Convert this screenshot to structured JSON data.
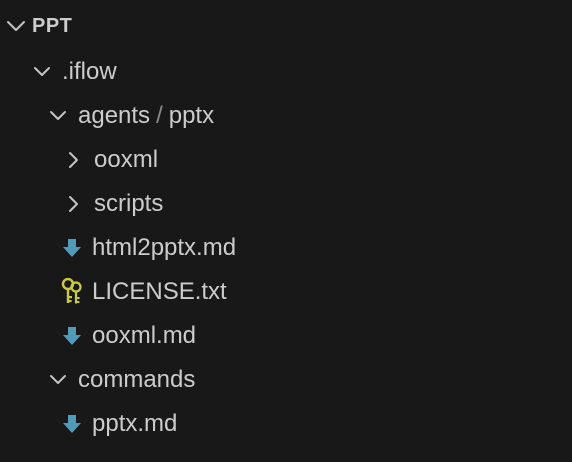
{
  "explorer": {
    "root": {
      "label": "PPT",
      "expanded": true
    },
    "items": [
      {
        "label": ".iflow",
        "type": "folder",
        "expanded": true
      },
      {
        "label_a": "agents",
        "separator": "/",
        "label_b": "pptx",
        "type": "folder-compact",
        "expanded": true
      },
      {
        "label": "ooxml",
        "type": "folder",
        "expanded": false
      },
      {
        "label": "scripts",
        "type": "folder",
        "expanded": false
      },
      {
        "label": "html2pptx.md",
        "type": "file",
        "icon": "markdown-download-icon"
      },
      {
        "label": "LICENSE.txt",
        "type": "file",
        "icon": "license-key-icon"
      },
      {
        "label": "ooxml.md",
        "type": "file",
        "icon": "markdown-download-icon"
      },
      {
        "label": "commands",
        "type": "folder",
        "expanded": true
      },
      {
        "label": "pptx.md",
        "type": "file",
        "icon": "markdown-download-icon"
      }
    ],
    "colors": {
      "background": "#181818",
      "text": "#cccccc",
      "chevron": "#c5c5c5",
      "markdown_icon": "#519aba",
      "license_icon": "#cbcb41"
    }
  }
}
